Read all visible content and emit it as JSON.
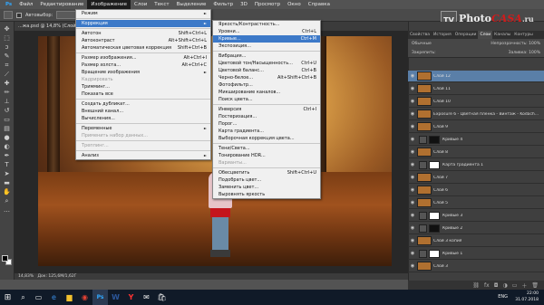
{
  "menubar": {
    "items": [
      "Ps",
      "Файл",
      "Редактирование",
      "Изображение",
      "Слои",
      "Текст",
      "Выделение",
      "Фильтр",
      "3D",
      "Просмотр",
      "Окно",
      "Справка"
    ],
    "active_index": 3
  },
  "options_bar": {
    "autoselect_label": "Автовыбор:"
  },
  "document_tab": {
    "title": "...жа.psd @ 14,8% (Слой 12, RGB/8) *"
  },
  "status_bar": {
    "zoom": "14,83%",
    "doc_info": "Док: 125,6М/1,62Г"
  },
  "image_menu": {
    "items": [
      {
        "label": "Режим",
        "shortcut": "",
        "submenu": true,
        "state": "normal"
      },
      {
        "sep": true
      },
      {
        "label": "Коррекция",
        "shortcut": "",
        "submenu": true,
        "state": "highlight"
      },
      {
        "sep": true
      },
      {
        "label": "Автотон",
        "shortcut": "Shift+Ctrl+L",
        "state": "normal"
      },
      {
        "label": "Автоконтраст",
        "shortcut": "Alt+Shift+Ctrl+L",
        "state": "normal"
      },
      {
        "label": "Автоматическая цветовая коррекция",
        "shortcut": "Shift+Ctrl+B",
        "state": "normal"
      },
      {
        "sep": true
      },
      {
        "label": "Размер изображения...",
        "shortcut": "Alt+Ctrl+I",
        "state": "normal"
      },
      {
        "label": "Размер холста...",
        "shortcut": "Alt+Ctrl+C",
        "state": "normal"
      },
      {
        "label": "Вращение изображения",
        "shortcut": "",
        "submenu": true,
        "state": "normal"
      },
      {
        "label": "Кадрировать",
        "shortcut": "",
        "state": "disabled"
      },
      {
        "label": "Тримминг...",
        "shortcut": "",
        "state": "normal"
      },
      {
        "label": "Показать все",
        "shortcut": "",
        "state": "normal"
      },
      {
        "sep": true
      },
      {
        "label": "Создать дубликат...",
        "shortcut": "",
        "state": "normal"
      },
      {
        "label": "Внешний канал...",
        "shortcut": "",
        "state": "normal"
      },
      {
        "label": "Вычисления...",
        "shortcut": "",
        "state": "normal"
      },
      {
        "sep": true
      },
      {
        "label": "Переменные",
        "shortcut": "",
        "submenu": true,
        "state": "normal"
      },
      {
        "label": "Применить набор данных...",
        "shortcut": "",
        "state": "disabled"
      },
      {
        "sep": true
      },
      {
        "label": "Треппинг...",
        "shortcut": "",
        "state": "disabled"
      },
      {
        "sep": true
      },
      {
        "label": "Анализ",
        "shortcut": "",
        "submenu": true,
        "state": "normal"
      }
    ]
  },
  "correction_menu": {
    "items": [
      {
        "label": "Яркость/Контрастность...",
        "shortcut": "",
        "state": "normal"
      },
      {
        "label": "Уровни...",
        "shortcut": "Ctrl+L",
        "state": "normal"
      },
      {
        "label": "Кривые...",
        "shortcut": "Ctrl+M",
        "state": "highlight"
      },
      {
        "label": "Экспозиция...",
        "shortcut": "",
        "state": "normal"
      },
      {
        "sep": true
      },
      {
        "label": "Вибрация...",
        "shortcut": "",
        "state": "normal"
      },
      {
        "label": "Цветовой тон/Насыщенность...",
        "shortcut": "Ctrl+U",
        "state": "normal"
      },
      {
        "label": "Цветовой баланс...",
        "shortcut": "Ctrl+B",
        "state": "normal"
      },
      {
        "label": "Черно-белое...",
        "shortcut": "Alt+Shift+Ctrl+B",
        "state": "normal"
      },
      {
        "label": "Фотофильтр...",
        "shortcut": "",
        "state": "normal"
      },
      {
        "label": "Микширование каналов...",
        "shortcut": "",
        "state": "normal"
      },
      {
        "label": "Поиск цвета...",
        "shortcut": "",
        "state": "normal"
      },
      {
        "sep": true
      },
      {
        "label": "Инверсия",
        "shortcut": "Ctrl+I",
        "state": "normal"
      },
      {
        "label": "Постеризация...",
        "shortcut": "",
        "state": "normal"
      },
      {
        "label": "Порог...",
        "shortcut": "",
        "state": "normal"
      },
      {
        "label": "Карта градиента...",
        "shortcut": "",
        "state": "normal"
      },
      {
        "label": "Выборочная коррекция цвета...",
        "shortcut": "",
        "state": "normal"
      },
      {
        "sep": true
      },
      {
        "label": "Тени/Света...",
        "shortcut": "",
        "state": "normal"
      },
      {
        "label": "Тонирование HDR...",
        "shortcut": "",
        "state": "normal"
      },
      {
        "label": "Варианты...",
        "shortcut": "",
        "state": "disabled"
      },
      {
        "sep": true
      },
      {
        "label": "Обесцветить",
        "shortcut": "Shift+Ctrl+U",
        "state": "normal"
      },
      {
        "label": "Подобрать цвет...",
        "shortcut": "",
        "state": "normal"
      },
      {
        "label": "Заменить цвет...",
        "shortcut": "",
        "state": "normal"
      },
      {
        "label": "Выровнять яркость",
        "shortcut": "",
        "state": "normal"
      }
    ]
  },
  "right_panel": {
    "tabs": [
      "Свойства",
      "История",
      "Операции",
      "Слои",
      "Каналы",
      "Контуры"
    ],
    "active_tab": 3,
    "kind_label": "Обычные",
    "opacity_label": "Непрозрачность:",
    "opacity_value": "100%",
    "lock_label": "Закрепить:",
    "fill_label": "Заливка:",
    "fill_value": "100%"
  },
  "layers": [
    {
      "name": "Слой 12",
      "thumb": "photo",
      "selected": true
    },
    {
      "name": "Слой 11",
      "thumb": "photo"
    },
    {
      "name": "Слой 10",
      "thumb": "photo"
    },
    {
      "name": "Exposure 6 - Цветная пленка - Винтаж - Kodach...",
      "thumb": "photo"
    },
    {
      "name": "Слой 9",
      "thumb": "photo"
    },
    {
      "name": "Кривые 4",
      "thumb": "adj",
      "mask": "dark"
    },
    {
      "name": "Слой 8",
      "thumb": "photo"
    },
    {
      "name": "Карта градиента 1",
      "thumb": "adj",
      "mask": "white"
    },
    {
      "name": "Слой 7",
      "thumb": "photo"
    },
    {
      "name": "Слой 6",
      "thumb": "photo"
    },
    {
      "name": "Слой 5",
      "thumb": "photo"
    },
    {
      "name": "Кривые 3",
      "thumb": "adj",
      "mask": "white"
    },
    {
      "name": "Кривые 2",
      "thumb": "adj",
      "mask": "dark"
    },
    {
      "name": "Слой 3 копия",
      "thumb": "photo"
    },
    {
      "name": "Кривые 1",
      "thumb": "adj",
      "mask": "white"
    },
    {
      "name": "Слой 3",
      "thumb": "photo"
    }
  ],
  "watermark": {
    "tv": "TV",
    "photo": "Photo",
    "casa": "CASA",
    "ru": ".ru"
  },
  "taskbar": {
    "icons": [
      "windows-start-icon",
      "search-icon",
      "task-view-icon",
      "edge-icon",
      "file-explorer-icon",
      "chrome-icon",
      "photoshop-icon",
      "word-icon",
      "yandex-icon",
      "mail-icon",
      "store-icon"
    ],
    "lang": "ENG",
    "time": "22:00",
    "date": "31.07.2018"
  }
}
